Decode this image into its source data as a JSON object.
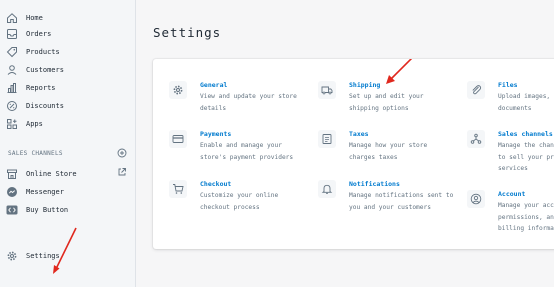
{
  "sidebar": {
    "items": [
      {
        "label": "Home"
      },
      {
        "label": "Orders"
      },
      {
        "label": "Products"
      },
      {
        "label": "Customers"
      },
      {
        "label": "Reports"
      },
      {
        "label": "Discounts"
      },
      {
        "label": "Apps"
      }
    ],
    "sales_channels_title": "SALES CHANNELS",
    "channels": [
      {
        "label": "Online Store"
      },
      {
        "label": "Messenger"
      },
      {
        "label": "Buy Button"
      }
    ],
    "settings_label": "Settings"
  },
  "main": {
    "title": "Settings",
    "items": [
      {
        "title": "General",
        "desc1": "View and update your store",
        "desc2": "details",
        "desc3": ""
      },
      {
        "title": "Shipping",
        "desc1": "Set up and edit your",
        "desc2": "shipping options",
        "desc3": ""
      },
      {
        "title": "Files",
        "desc1": "Upload images, vi",
        "desc2": "documents",
        "desc3": ""
      },
      {
        "title": "Payments",
        "desc1": "Enable and manage your",
        "desc2": "store's payment providers",
        "desc3": ""
      },
      {
        "title": "Taxes",
        "desc1": "Manage how your store",
        "desc2": "charges taxes",
        "desc3": ""
      },
      {
        "title": "Sales channels",
        "desc1": "Manage the channe",
        "desc2": "to sell your prod",
        "desc3": "services"
      },
      {
        "title": "Checkout",
        "desc1": "Customize your online",
        "desc2": "checkout process",
        "desc3": ""
      },
      {
        "title": "Notifications",
        "desc1": "Manage notifications sent to",
        "desc2": "you and your customers",
        "desc3": ""
      },
      {
        "title": "Account",
        "desc1": "Manage your accou",
        "desc2": "permissions, and",
        "desc3": "billing informati"
      }
    ]
  },
  "colors": {
    "link": "#007ace",
    "annotation_arrow": "#e0281e",
    "sidebar_bg": "#f4f6f8",
    "page_bg": "#f6f6f7"
  },
  "icons": [
    "home-icon",
    "orders-icon",
    "products-icon",
    "customers-icon",
    "reports-icon",
    "discounts-icon",
    "apps-icon",
    "add-icon",
    "external-link-icon",
    "store-icon",
    "messenger-icon",
    "buy-button-icon",
    "settings-icon",
    "general-icon",
    "shipping-icon",
    "files-icon",
    "payments-icon",
    "taxes-icon",
    "sales-channels-icon",
    "checkout-icon",
    "notifications-icon",
    "account-icon"
  ]
}
